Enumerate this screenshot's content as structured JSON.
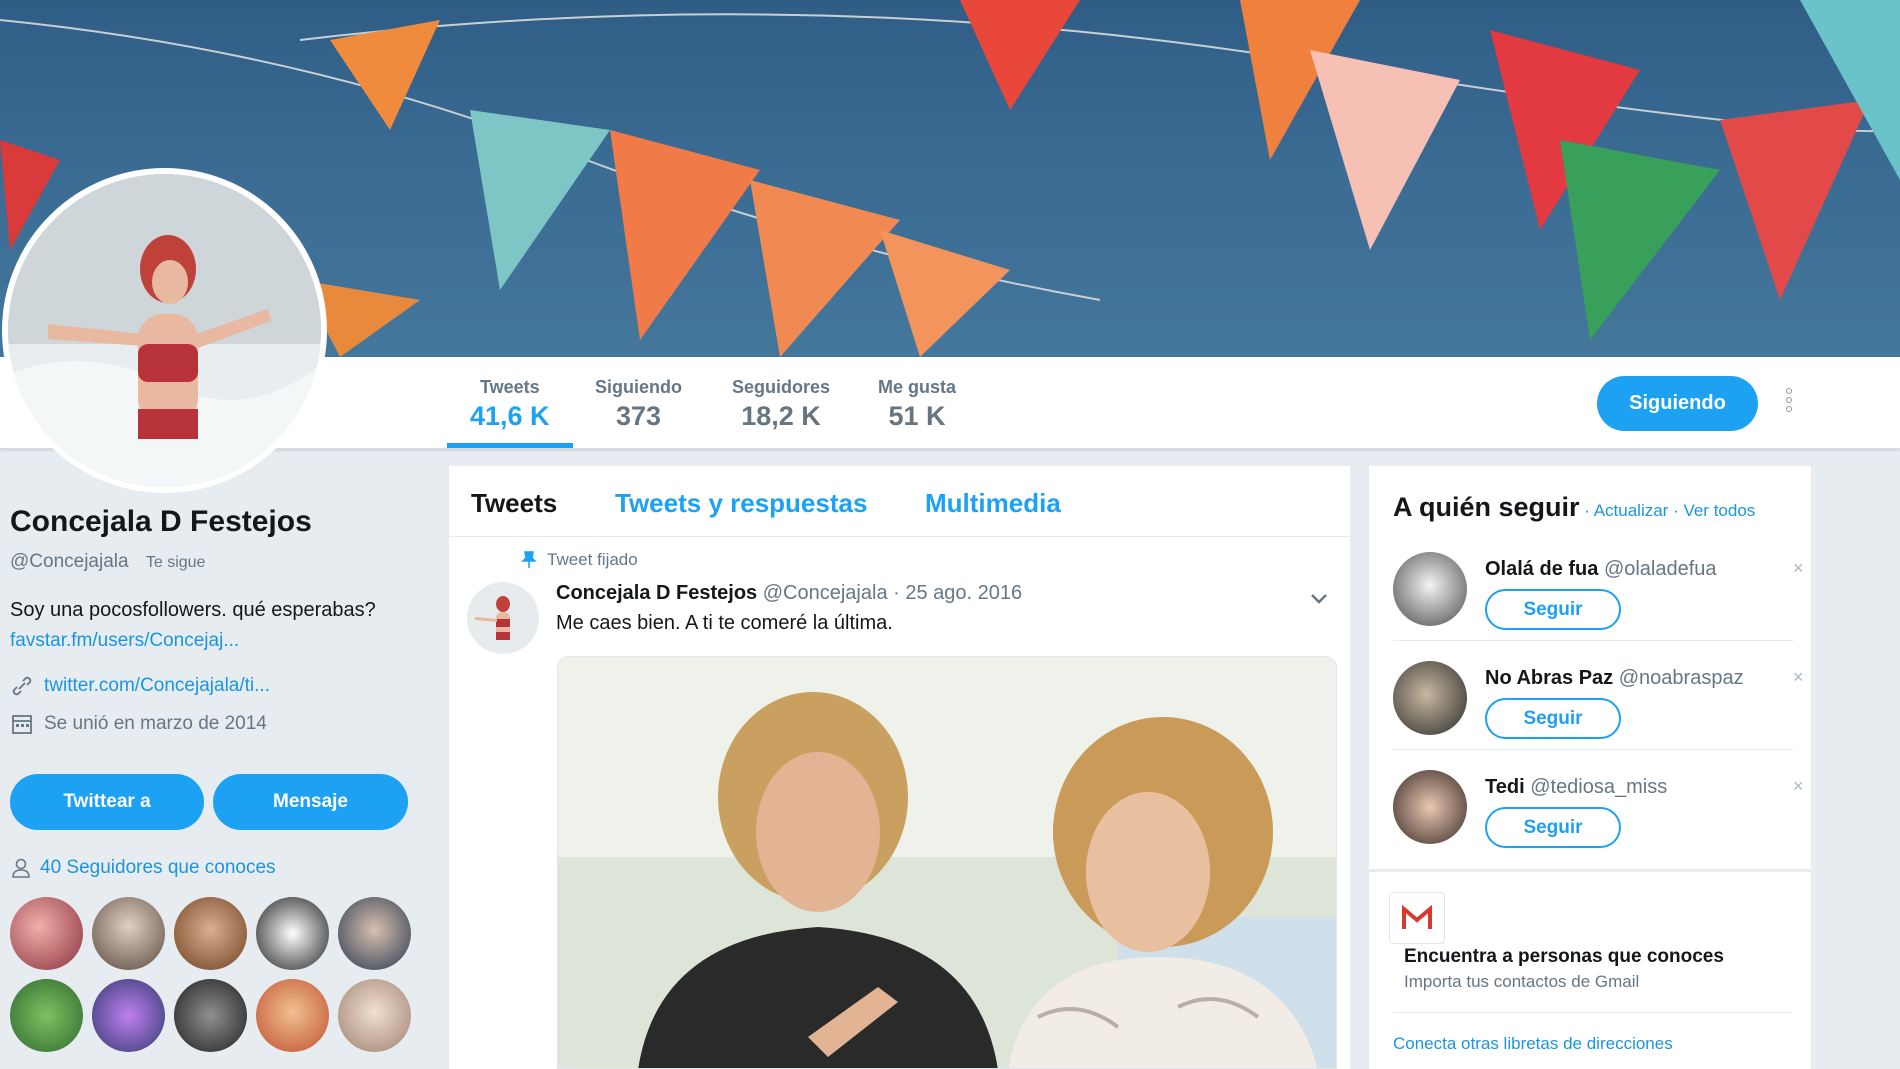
{
  "profile": {
    "name": "Concejala D Festejos",
    "handle": "@Concejajala",
    "follows_you": "Te sigue",
    "bio": "Soy una pocosfollowers. qué esperabas?",
    "bio_link": "favstar.fm/users/Concejaj...",
    "website": "twitter.com/Concejajala/ti...",
    "joined": "Se unió en marzo de 2014",
    "tweet_to_button": "Twittear a",
    "message_button": "Mensaje",
    "followers_you_know": "40 Seguidores que conoces"
  },
  "stats": [
    {
      "label": "Tweets",
      "value": "41,6 K"
    },
    {
      "label": "Siguiendo",
      "value": "373"
    },
    {
      "label": "Seguidores",
      "value": "18,2 K"
    },
    {
      "label": "Me gusta",
      "value": "51 K"
    }
  ],
  "follow_button": "Siguiendo",
  "tabs": [
    "Tweets",
    "Tweets y respuestas",
    "Multimedia"
  ],
  "tweet": {
    "pinned_label": "Tweet fijado",
    "author": "Concejala D Festejos",
    "handle_date": "@Concejajala · 25 ago. 2016",
    "text": "Me caes bien. A ti te comeré la última."
  },
  "who_to_follow": {
    "title": "A quién seguir",
    "refresh": " · Actualizar",
    "view_all": " · Ver todos",
    "suggestions": [
      {
        "name": "Olalá de fua",
        "handle": "@olaladefua",
        "button": "Seguir",
        "close": "×"
      },
      {
        "name": "No Abras Paz",
        "handle": "@noabraspaz",
        "button": "Seguir",
        "close": "×"
      },
      {
        "name": "Tedi",
        "handle": "@tediosa_miss",
        "button": "Seguir",
        "close": "×"
      }
    ],
    "gmail_title": "Encuentra a personas que conoces",
    "gmail_sub": "Importa tus contactos de Gmail",
    "connect_link": "Conecta otras libretas de direcciones"
  },
  "colors": {
    "accent": "#1da1f2",
    "background": "#e6ecf0"
  }
}
